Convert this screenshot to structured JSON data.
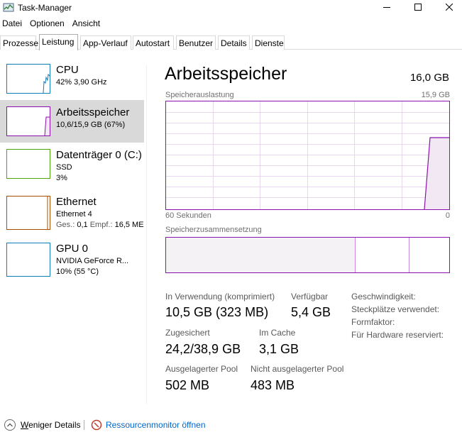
{
  "window": {
    "title": "Task-Manager"
  },
  "menu": [
    "Datei",
    "Optionen",
    "Ansicht"
  ],
  "tabs": [
    {
      "label": "Prozesse"
    },
    {
      "label": "Leistung"
    },
    {
      "label": "App-Verlauf"
    },
    {
      "label": "Autostart"
    },
    {
      "label": "Benutzer"
    },
    {
      "label": "Details"
    },
    {
      "label": "Dienste"
    }
  ],
  "active_tab": "Leistung",
  "sidebar": {
    "items": [
      {
        "title": "CPU",
        "line1": "42% 3,90 GHz",
        "line2": "",
        "color": "#117dbb",
        "selected": false
      },
      {
        "title": "Arbeitsspeicher",
        "line1": "10,6/15,9 GB (67%)",
        "line2": "",
        "color": "#8b12ae",
        "selected": true
      },
      {
        "title": "Datenträger 0 (C:)",
        "line1": "SSD",
        "line2": "3%",
        "color": "#4da60c",
        "selected": false
      },
      {
        "title": "Ethernet",
        "line1": "Ethernet 4",
        "line2_label_sent": "Ges.:",
        "line2_sent": "0,1",
        "line2_label_recv": "Empf.:",
        "line2_recv": "16,5 ME",
        "color": "#a74f01",
        "selected": false
      },
      {
        "title": "GPU 0",
        "line1": "NVIDIA GeForce R...",
        "line2": "10% (55 °C)",
        "color": "#117dbb",
        "selected": false
      }
    ]
  },
  "main": {
    "title": "Arbeitsspeicher",
    "total": "16,0 GB",
    "usage_graph": {
      "label": "Speicherauslastung",
      "max_label": "15,9 GB",
      "time_left": "60 Sekunden",
      "time_right": "0",
      "accent": "#8b12ae"
    },
    "composition": {
      "label": "Speicherzusammensetzung"
    },
    "stats": {
      "in_use_label": "In Verwendung (komprimiert)",
      "in_use_value": "10,5 GB (323 MB)",
      "available_label": "Verfügbar",
      "available_value": "5,4 GB",
      "committed_label": "Zugesichert",
      "committed_value": "24,2/38,9 GB",
      "cached_label": "Im Cache",
      "cached_value": "3,1 GB",
      "paged_label": "Ausgelagerter Pool",
      "paged_value": "502 MB",
      "nonpaged_label": "Nicht ausgelagerter Pool",
      "nonpaged_value": "483 MB"
    },
    "properties": {
      "speed": "Geschwindigkeit:",
      "slots": "Steckplätze verwendet:",
      "form_factor": "Formfaktor:",
      "hw_reserved": "Für Hardware reserviert:"
    }
  },
  "footer": {
    "less_details": "Weniger Details",
    "less_details_accel": "W",
    "less_details_rest": "eniger Details",
    "resource_monitor": "Ressourcenmonitor öffnen"
  }
}
